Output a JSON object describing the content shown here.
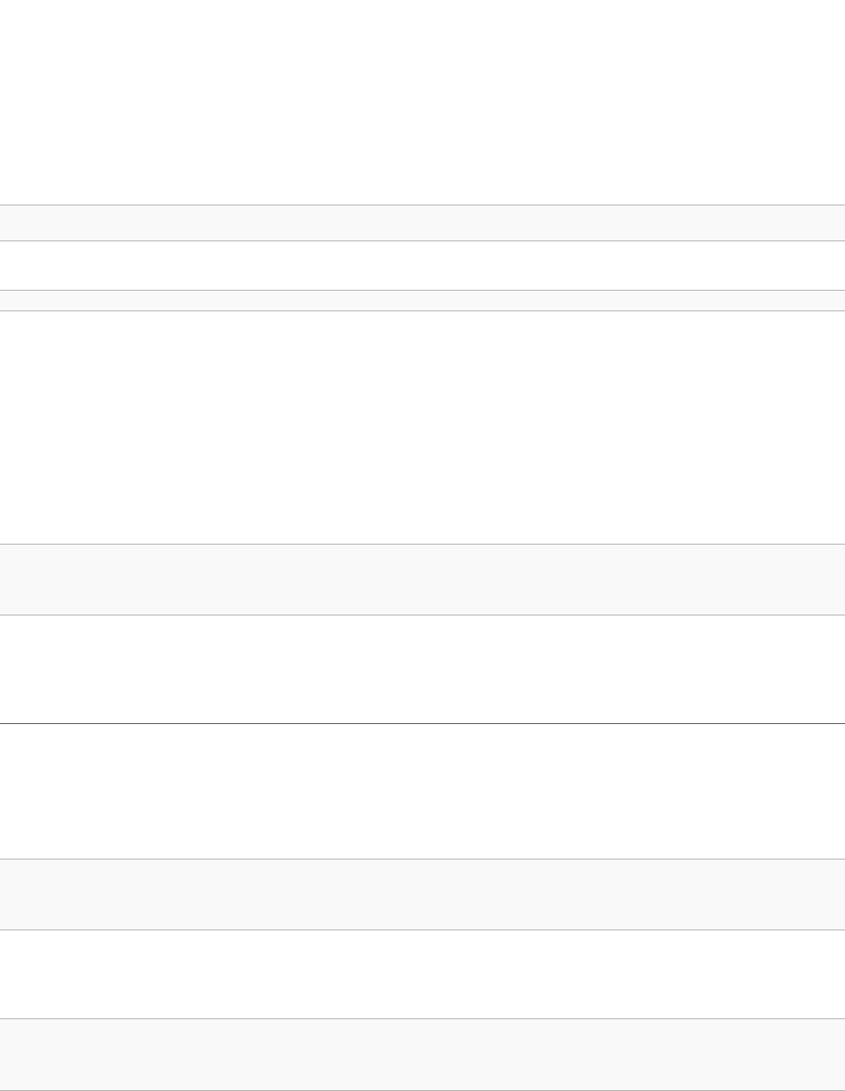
{
  "toolbar": {
    "stop_icon": "stop-square-icon"
  },
  "rows": [
    {
      "id": "row-1",
      "shade": "gray"
    },
    {
      "id": "row-2",
      "shade": "white"
    },
    {
      "id": "row-3",
      "shade": "gray"
    },
    {
      "id": "row-4",
      "shade": "white"
    },
    {
      "id": "row-5",
      "shade": "gray"
    },
    {
      "id": "row-6",
      "shade": "white"
    },
    {
      "id": "row-7",
      "shade": "white"
    },
    {
      "id": "row-8",
      "shade": "gray"
    },
    {
      "id": "row-9",
      "shade": "white"
    },
    {
      "id": "row-10",
      "shade": "gray"
    }
  ],
  "colors": {
    "background": "#ffffff",
    "band_gray": "#f9f9f9",
    "divider": "#b5b5b5",
    "divider_dark": "#5a5a5a",
    "icon": "#000000"
  }
}
